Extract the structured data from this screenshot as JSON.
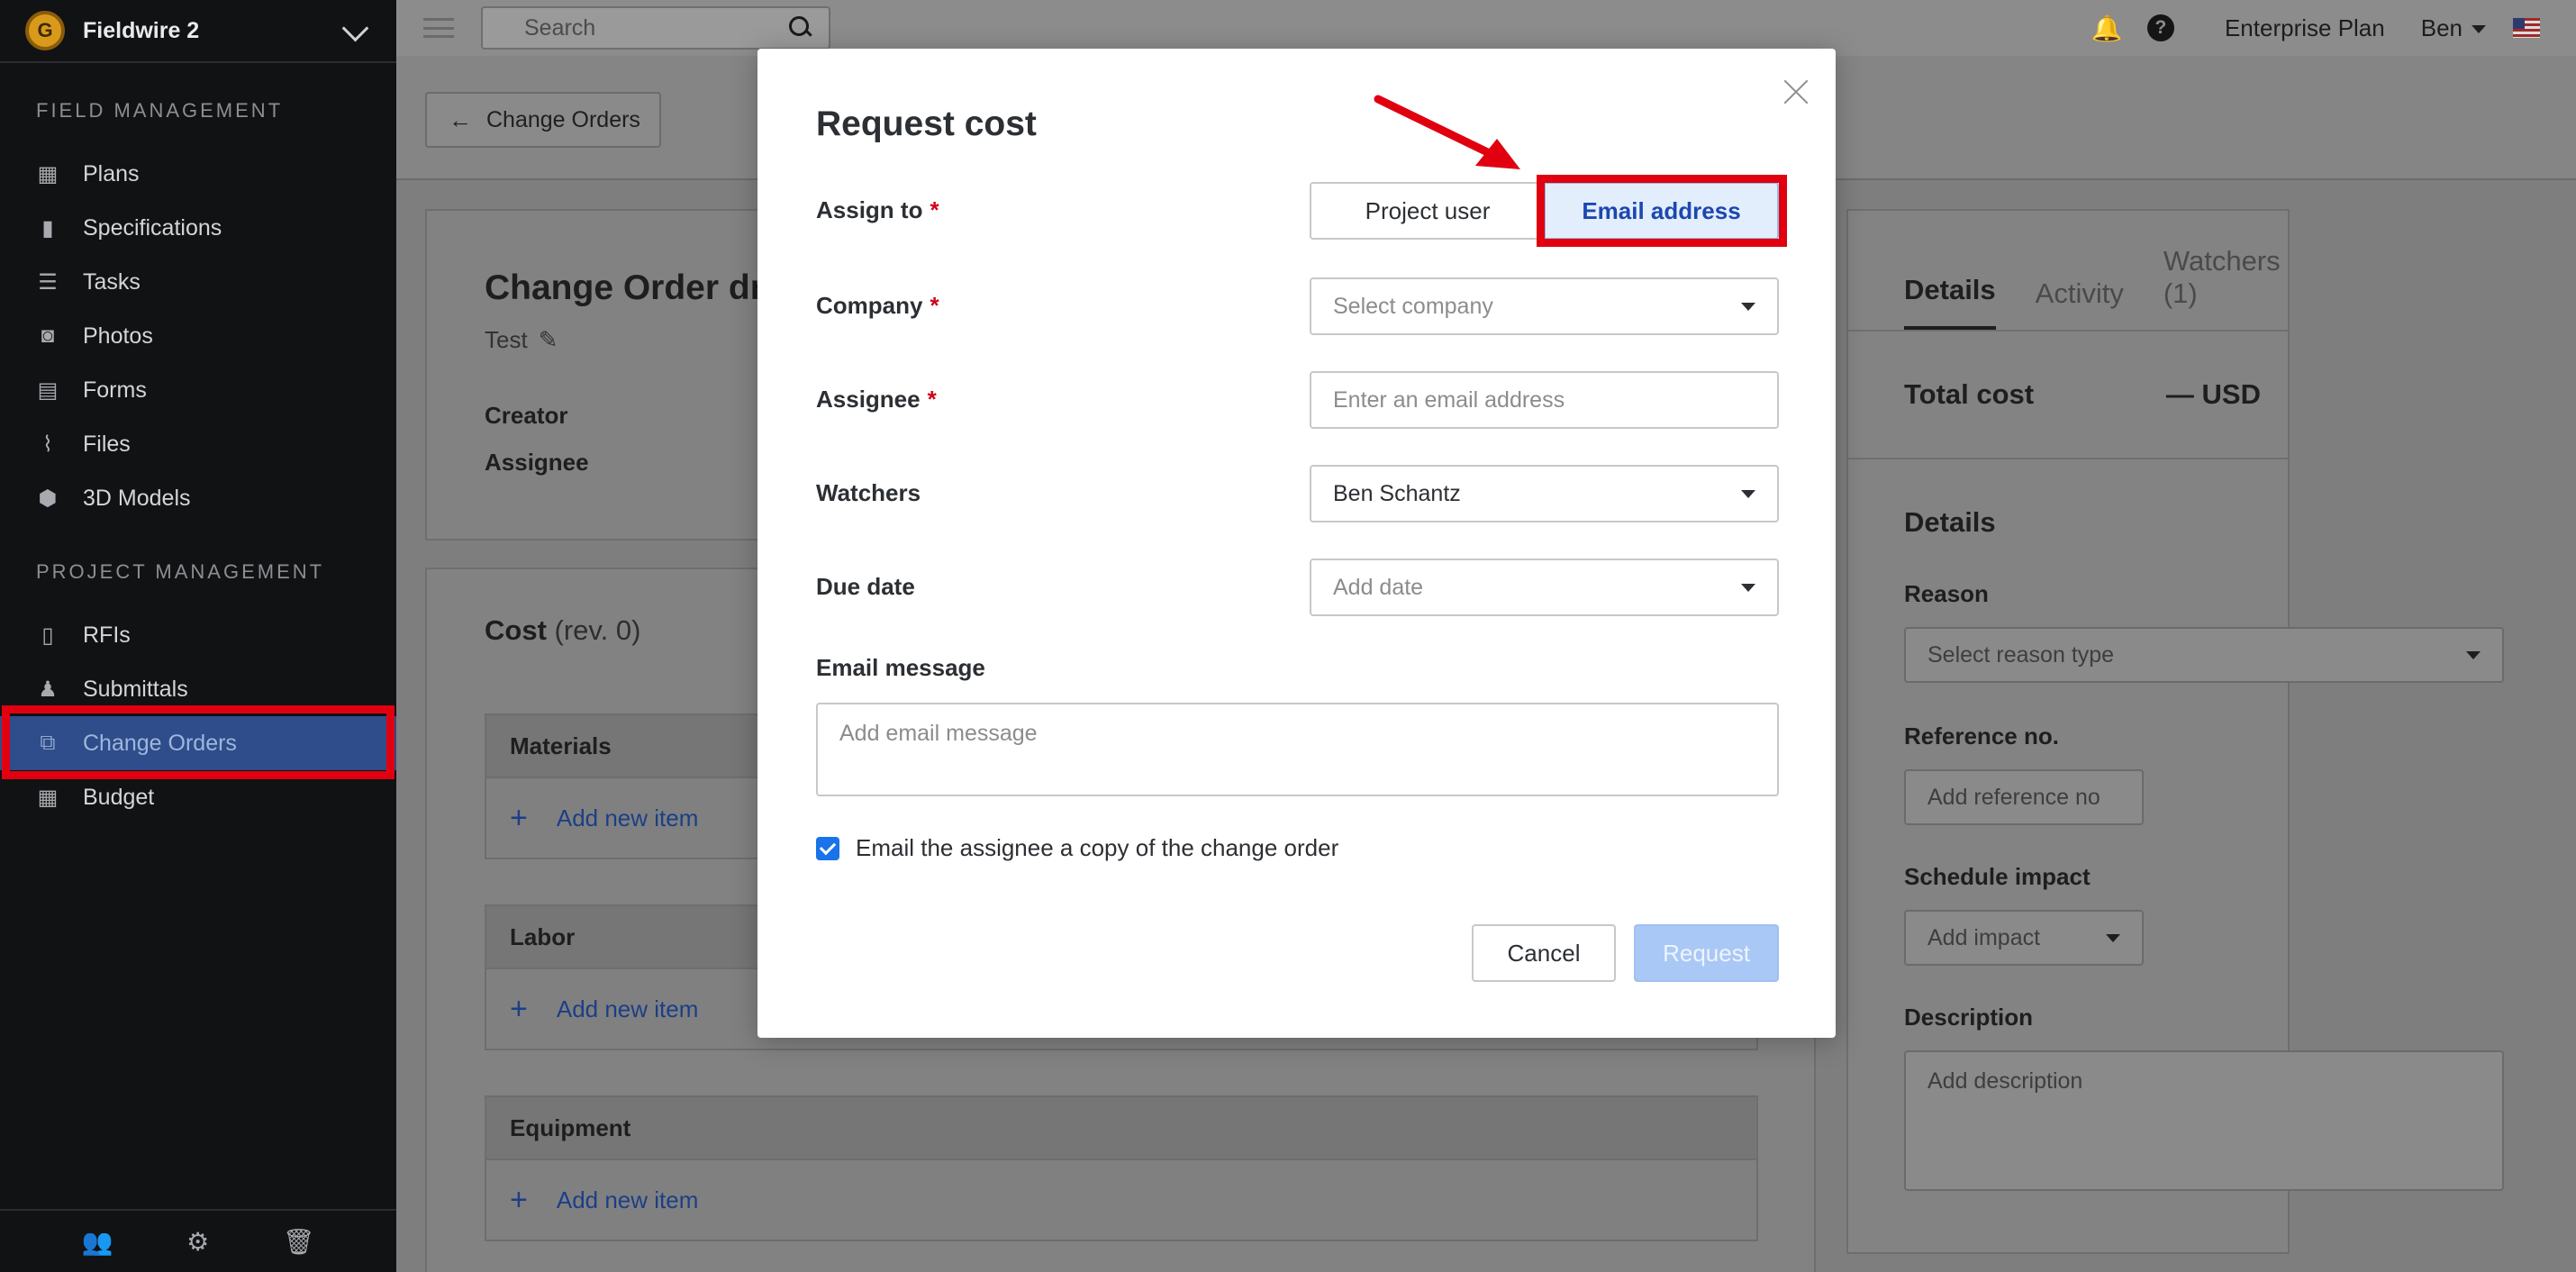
{
  "sidebar": {
    "project_name": "Fieldwire 2",
    "logo_letter": "G",
    "section_field": "FIELD MANAGEMENT",
    "section_project": "PROJECT MANAGEMENT",
    "field_items": [
      {
        "label": "Plans",
        "icon": "plans-icon"
      },
      {
        "label": "Specifications",
        "icon": "book-icon"
      },
      {
        "label": "Tasks",
        "icon": "list-icon"
      },
      {
        "label": "Photos",
        "icon": "camera-icon"
      },
      {
        "label": "Forms",
        "icon": "clipboard-icon"
      },
      {
        "label": "Files",
        "icon": "paperclip-icon"
      },
      {
        "label": "3D Models",
        "icon": "cube-icon"
      }
    ],
    "project_items": [
      {
        "label": "RFIs",
        "icon": "document-question-icon"
      },
      {
        "label": "Submittals",
        "icon": "stamp-icon"
      },
      {
        "label": "Change Orders",
        "icon": "change-orders-icon",
        "active": true
      },
      {
        "label": "Budget",
        "icon": "calculator-icon"
      }
    ]
  },
  "topbar": {
    "search_placeholder": "Search",
    "plan_label": "Enterprise Plan",
    "user_name": "Ben",
    "help_symbol": "?"
  },
  "main": {
    "back_label": "Change Orders",
    "co_title": "Change Order dra",
    "co_description": "Test",
    "creator_label": "Creator",
    "assignee_label": "Assignee",
    "cost_title": "Cost",
    "cost_rev": "(rev. 0)",
    "cost_sections": [
      {
        "title": "Materials",
        "add_label": "Add new item"
      },
      {
        "title": "Labor",
        "add_label": "Add new item"
      },
      {
        "title": "Equipment",
        "add_label": "Add new item"
      }
    ]
  },
  "right_panel": {
    "tabs": [
      {
        "label": "Details",
        "active": true
      },
      {
        "label": "Activity",
        "active": false
      },
      {
        "label": "Watchers (1)",
        "active": false
      }
    ],
    "total_cost_label": "Total cost",
    "total_cost_value": "— USD",
    "details_title": "Details",
    "reason_label": "Reason",
    "reason_placeholder": "Select reason type",
    "reference_label": "Reference no.",
    "reference_placeholder": "Add reference no",
    "schedule_label": "Schedule impact",
    "schedule_placeholder": "Add impact",
    "description_label": "Description",
    "description_placeholder": "Add description"
  },
  "modal": {
    "title": "Request cost",
    "assign_to_label": "Assign to",
    "assign_options": [
      "Project user",
      "Email address"
    ],
    "assign_selected": "Email address",
    "company_label": "Company",
    "company_placeholder": "Select company",
    "assignee_label": "Assignee",
    "assignee_placeholder": "Enter an email address",
    "watchers_label": "Watchers",
    "watchers_value": "Ben Schantz",
    "due_date_label": "Due date",
    "due_date_placeholder": "Add date",
    "email_message_label": "Email message",
    "email_message_placeholder": "Add email message",
    "copy_checkbox_label": "Email the assignee a copy of the change order",
    "copy_checked": true,
    "required_mark": "*",
    "cancel_label": "Cancel",
    "request_label": "Request"
  },
  "colors": {
    "annotation_red": "#e0000f",
    "primary_blue": "#1a73e8",
    "selected_text": "#1c47b0",
    "sidebar_bg": "#111214"
  }
}
